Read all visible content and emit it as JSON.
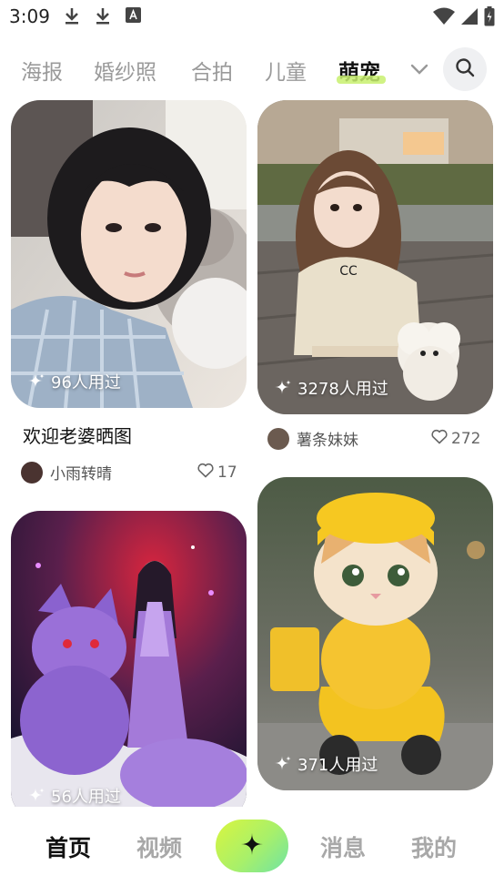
{
  "status_bar": {
    "time": "3:09"
  },
  "tabs": [
    "海报",
    "婚纱照",
    "合拍",
    "儿童",
    "萌宠"
  ],
  "active_tab": "萌宠",
  "cards": [
    {
      "uses": "96人用过",
      "title": "欢迎老婆晒图",
      "author": "小雨转晴",
      "likes": "17"
    },
    {
      "uses": "3278人用过",
      "author": "薯条妹妹",
      "likes": "272"
    },
    {
      "uses": "56人用过"
    },
    {
      "uses": "371人用过"
    }
  ],
  "bottom_nav": {
    "home": "首页",
    "video": "视频",
    "messages": "消息",
    "mine": "我的"
  },
  "colors": {
    "accent_start": "#d9f53f",
    "accent_end": "#6fe3a4",
    "active_underline": "#c8f06e"
  }
}
